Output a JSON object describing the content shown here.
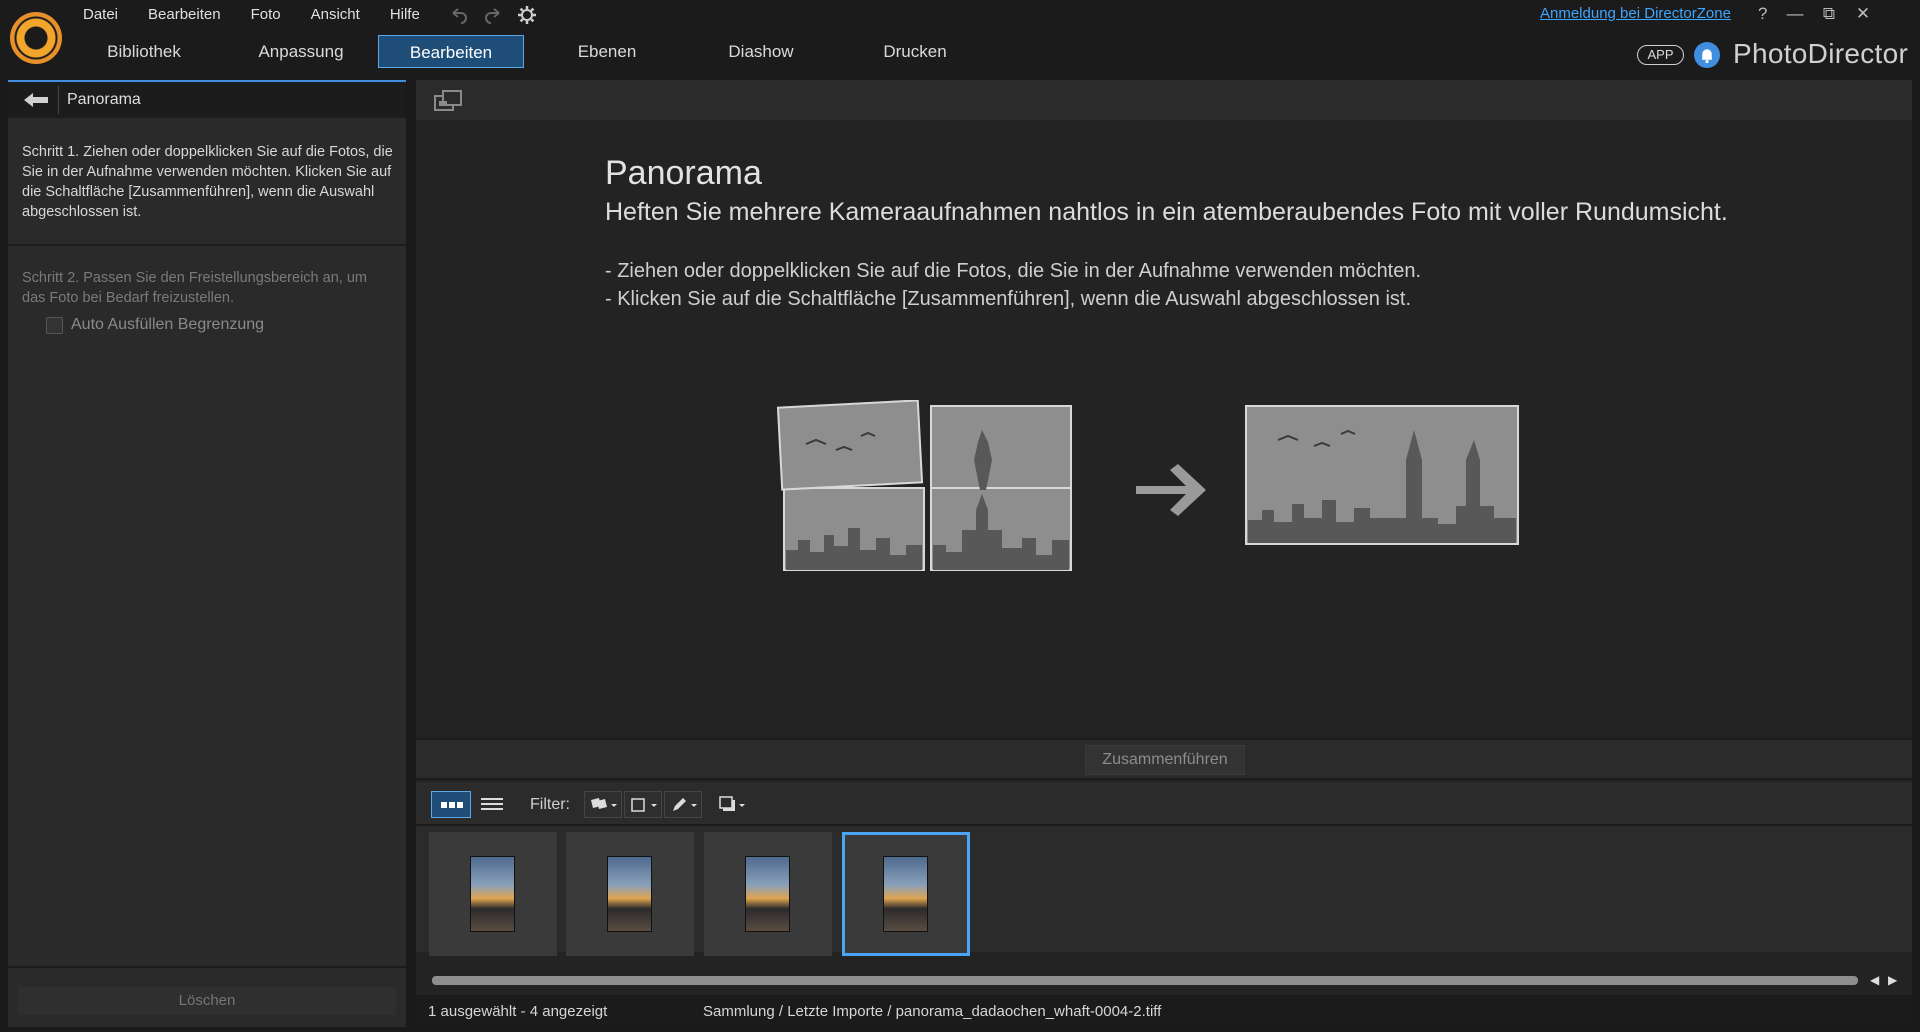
{
  "menu": [
    "Datei",
    "Bearbeiten",
    "Foto",
    "Ansicht",
    "Hilfe"
  ],
  "modules": [
    {
      "label": "Bibliothek",
      "active": false
    },
    {
      "label": "Anpassung",
      "active": false
    },
    {
      "label": "Bearbeiten",
      "active": true
    },
    {
      "label": "Ebenen",
      "active": false
    },
    {
      "label": "Diashow",
      "active": false
    },
    {
      "label": "Drucken",
      "active": false
    }
  ],
  "topright": {
    "login_link": "Anmeldung bei DirectorZone",
    "help": "?",
    "minimize": "—",
    "restore": "⧉",
    "close": "✕",
    "app_badge": "APP",
    "brand": "PhotoDirector"
  },
  "left_panel": {
    "title": "Panorama",
    "step1": "Schritt 1. Ziehen oder doppelklicken Sie auf die Fotos, die Sie in der Aufnahme verwenden möchten. Klicken Sie auf die Schaltfläche [Zusammenführen], wenn die Auswahl abgeschlossen ist.",
    "step2": "Schritt 2. Passen Sie den Freistellungsbereich an, um das Foto bei Bedarf freizustellen.",
    "auto_fill_label": "Auto Ausfüllen Begrenzung",
    "auto_fill_checked": false,
    "delete_label": "Löschen"
  },
  "content": {
    "title": "Panorama",
    "subtitle": "Heften Sie mehrere Kameraaufnahmen nahtlos in ein atemberaubendes Foto mit voller Rundumsicht.",
    "bullet1": "- Ziehen oder doppelklicken Sie auf die Fotos, die Sie in der Aufnahme verwenden möchten.",
    "bullet2": "- Klicken Sie auf die Schaltfläche [Zusammenführen], wenn die Auswahl abgeschlossen ist."
  },
  "merge_label": "Zusammenführen",
  "filmstrip": {
    "filter_label": "Filter:",
    "thumbnails": [
      {
        "selected": false
      },
      {
        "selected": false
      },
      {
        "selected": false
      },
      {
        "selected": true
      }
    ]
  },
  "status": {
    "count": "1 ausgewählt - 4 angezeigt",
    "path": "Sammlung / Letzte Importe / panorama_dadaochen_whaft-0004-2.tiff"
  },
  "colors": {
    "accent": "#3f8ee0",
    "active_tab": "#1e4d78",
    "link": "#3ea6ff"
  }
}
